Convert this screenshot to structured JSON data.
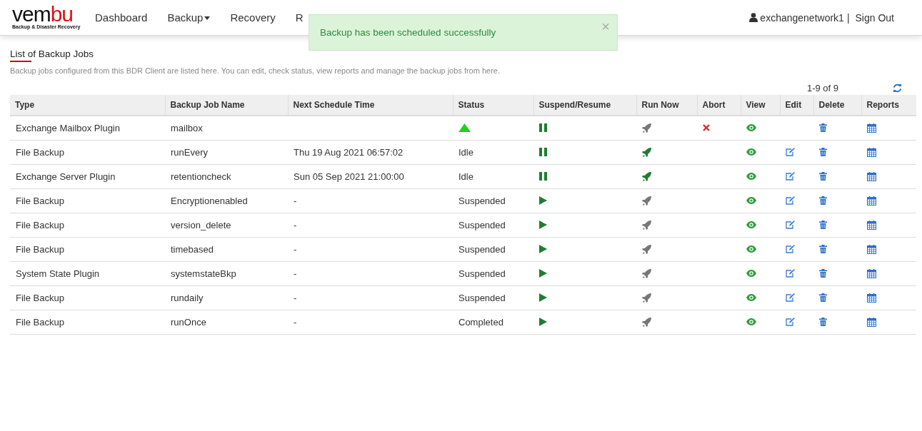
{
  "logo": {
    "word_start": "vem",
    "word_end": "bu",
    "tagline": "Backup & Disaster Recovery"
  },
  "nav": [
    {
      "label": "Dashboard",
      "dropdown": false
    },
    {
      "label": "Backup",
      "dropdown": true
    },
    {
      "label": "Recovery",
      "dropdown": false
    },
    {
      "label": "R",
      "dropdown": false
    }
  ],
  "user": {
    "name": "exchangenetwork1",
    "separator": "|",
    "sign_out": "Sign Out"
  },
  "toast": {
    "message": "Backup has been scheduled successfully",
    "close": "×"
  },
  "page": {
    "title": "List of Backup Jobs",
    "description": "Backup jobs configured from this BDR Client are listed here. You can edit, check status, view reports and manage the backup jobs from here."
  },
  "pagination": "1-9 of 9",
  "table": {
    "columns": [
      "Type",
      "Backup Job Name",
      "Next Schedule Time",
      "Status",
      "Suspend/Resume",
      "Run Now",
      "Abort",
      "View",
      "Edit",
      "Delete",
      "Reports"
    ],
    "rows": [
      {
        "type": "Exchange Mailbox Plugin",
        "name": "mailbox",
        "next": "",
        "running": true,
        "status": "",
        "resumable": false,
        "run_enabled": false,
        "abortable": true,
        "editable": false
      },
      {
        "type": "File Backup",
        "name": "runEvery",
        "next": "Thu 19 Aug 2021 06:57:02",
        "running": false,
        "status": "Idle",
        "resumable": false,
        "run_enabled": true,
        "abortable": false,
        "editable": true
      },
      {
        "type": "Exchange Server Plugin",
        "name": "retentioncheck",
        "next": "Sun 05 Sep 2021 21:00:00",
        "running": false,
        "status": "Idle",
        "resumable": false,
        "run_enabled": true,
        "abortable": false,
        "editable": true
      },
      {
        "type": "File Backup",
        "name": "Encryptionenabled",
        "next": "-",
        "running": false,
        "status": "Suspended",
        "resumable": true,
        "run_enabled": false,
        "abortable": false,
        "editable": true
      },
      {
        "type": "File Backup",
        "name": "version_delete",
        "next": "-",
        "running": false,
        "status": "Suspended",
        "resumable": true,
        "run_enabled": false,
        "abortable": false,
        "editable": true
      },
      {
        "type": "File Backup",
        "name": "timebased",
        "next": "-",
        "running": false,
        "status": "Suspended",
        "resumable": true,
        "run_enabled": false,
        "abortable": false,
        "editable": true
      },
      {
        "type": "System State Plugin",
        "name": "systemstateBkp",
        "next": "-",
        "running": false,
        "status": "Suspended",
        "resumable": true,
        "run_enabled": false,
        "abortable": false,
        "editable": true
      },
      {
        "type": "File Backup",
        "name": "rundaily",
        "next": "-",
        "running": false,
        "status": "Suspended",
        "resumable": true,
        "run_enabled": false,
        "abortable": false,
        "editable": true
      },
      {
        "type": "File Backup",
        "name": "runOnce",
        "next": "-",
        "running": false,
        "status": "Completed",
        "resumable": true,
        "run_enabled": false,
        "abortable": false,
        "editable": true
      }
    ]
  }
}
